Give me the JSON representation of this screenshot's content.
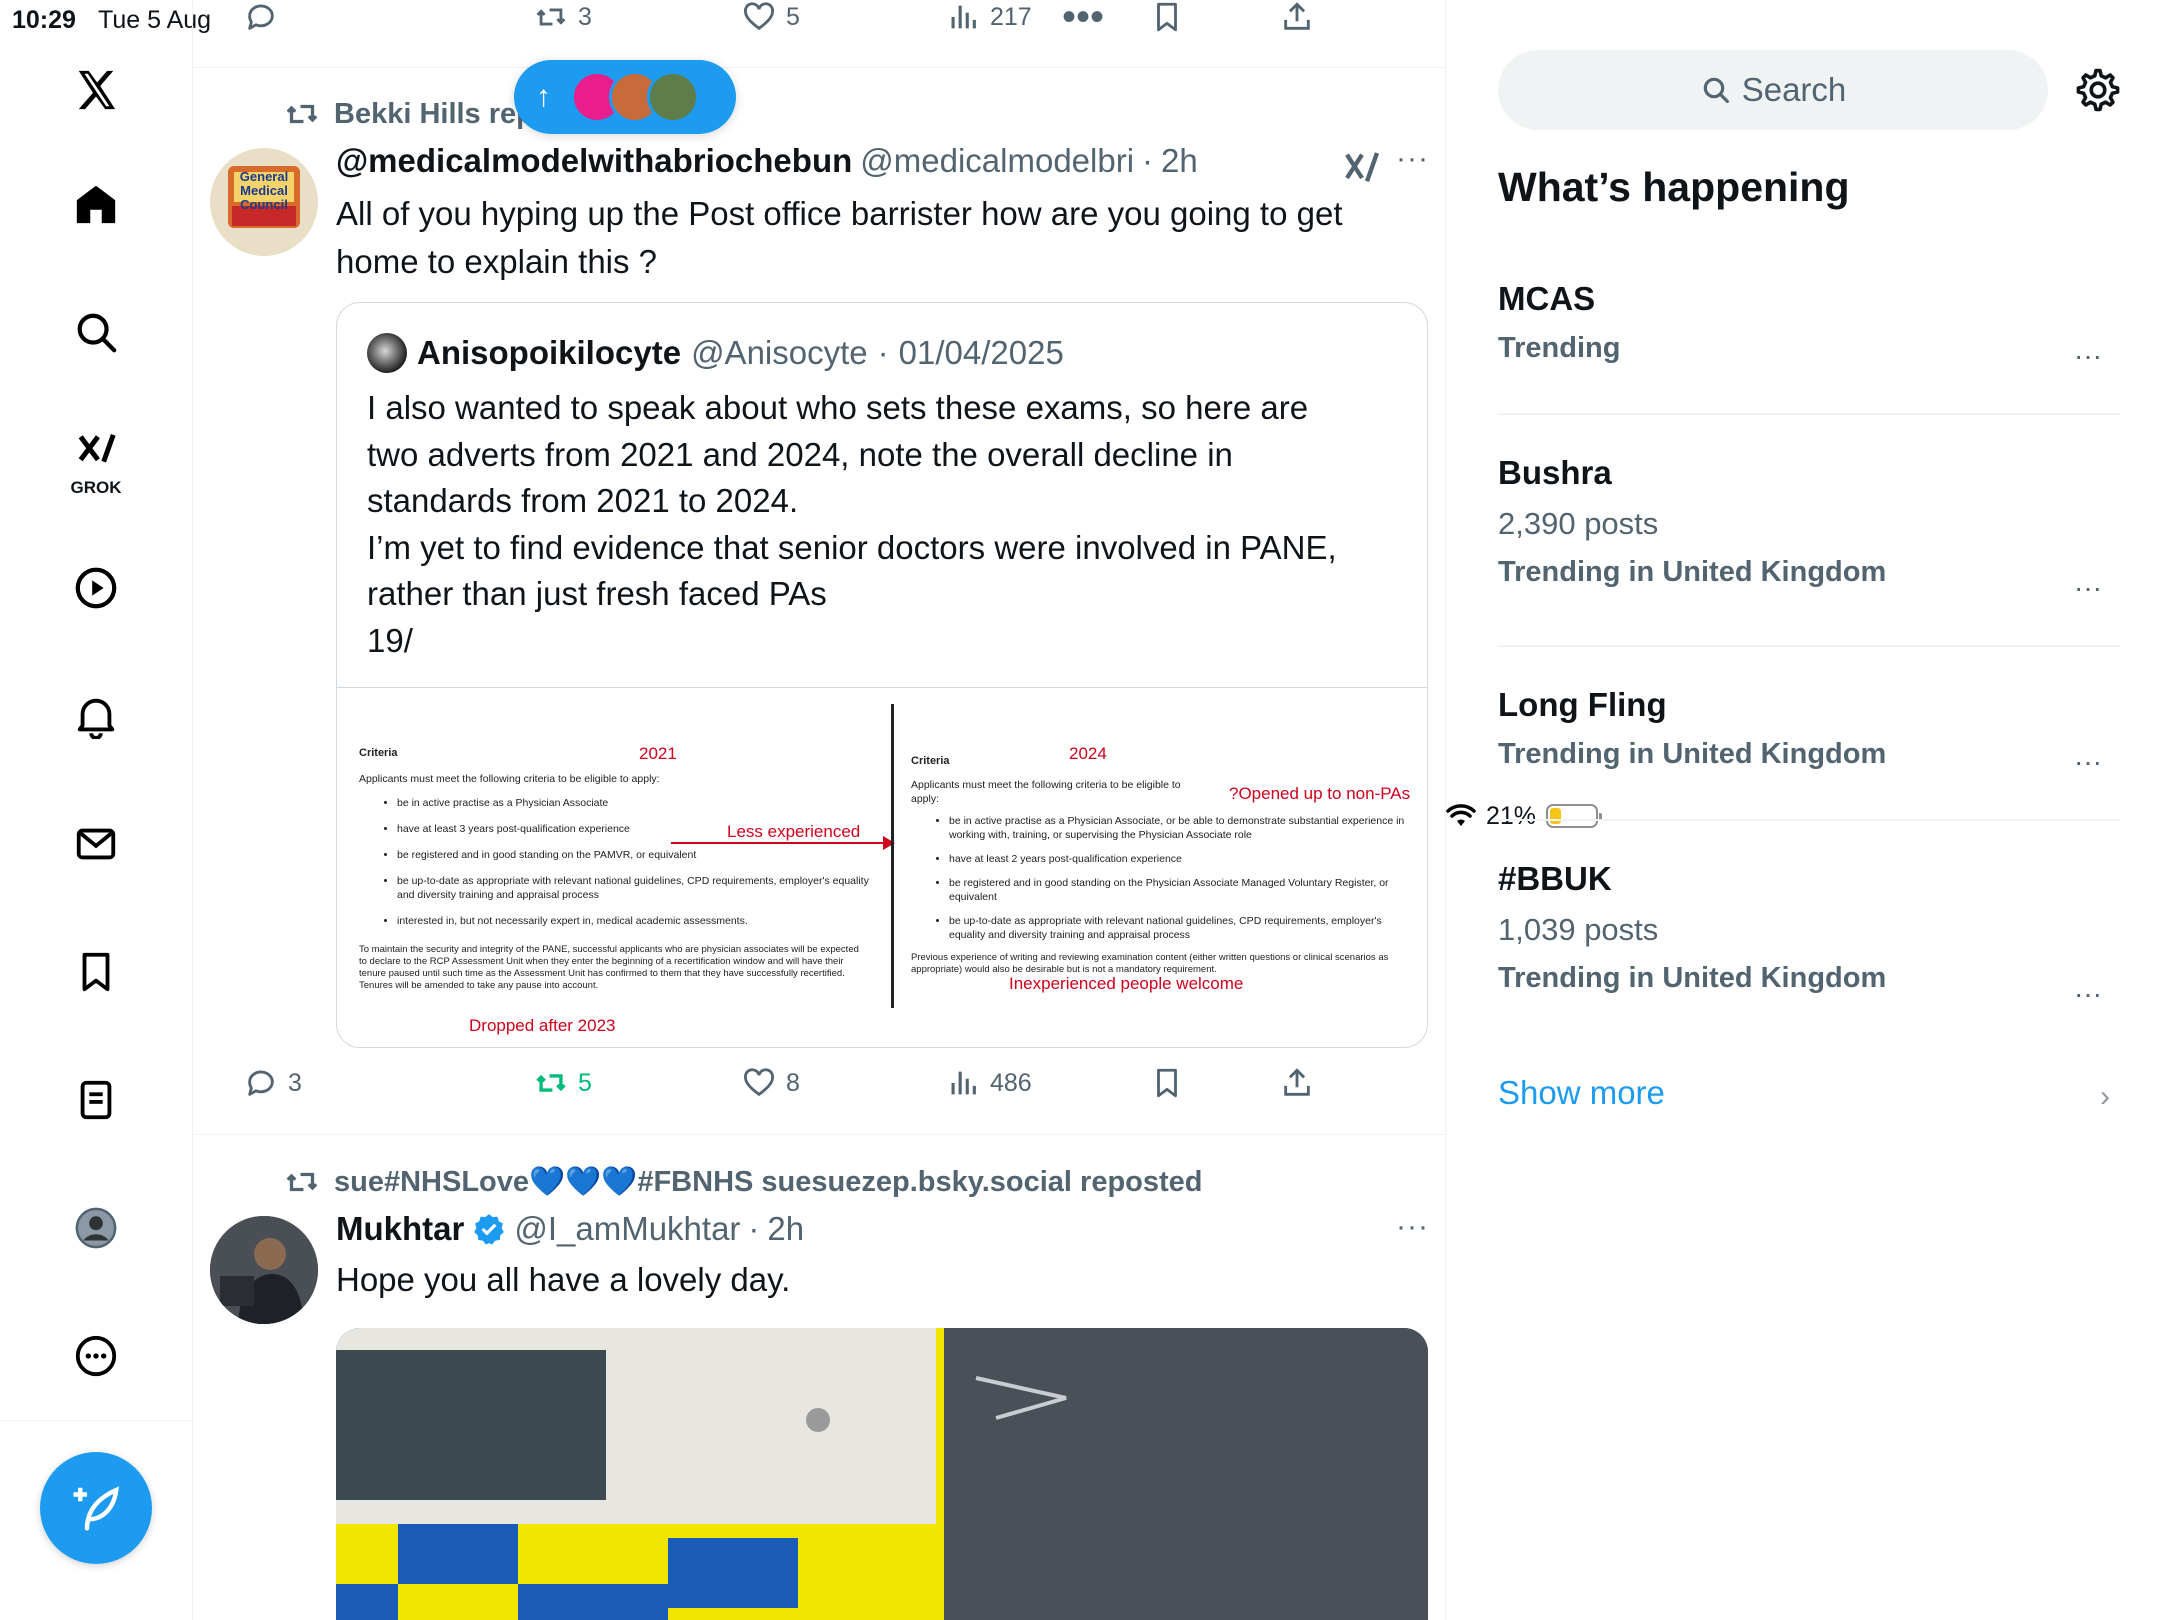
{
  "status_bar": {
    "time": "10:29",
    "date": "Tue 5 Aug",
    "battery": "21%"
  },
  "top_post_actions": {
    "replies": "",
    "reposts": "3",
    "likes": "5",
    "views": "217"
  },
  "new_posts_pill": {
    "arrow": "↑"
  },
  "post1": {
    "repost_by": "Bekki Hills reposted",
    "name": "@medicalmodelwithabriochebun",
    "handle": "@medicalmodelbri",
    "sep": "·",
    "time": "2h",
    "text": "All of you hyping up the Post office barrister how are you going to get home to explain this ?",
    "avatar_text": "General Medical Council",
    "quote": {
      "name": "Anisopoikilocyte",
      "handle": "@Anisocyte",
      "sep": "·",
      "date": "01/04/2025",
      "text_lines": [
        "I also wanted to speak about who sets these exams, so here are",
        "two adverts from 2021 and 2024, note the overall decline in",
        "standards from 2021 to 2024.",
        "I’m yet to find evidence that senior doctors were involved in PANE,",
        "rather than just fresh faced PAs",
        "19/"
      ],
      "image": {
        "left_year": "2021",
        "right_year": "2024",
        "criteria": "Criteria",
        "intro": "Applicants must meet the following criteria to be eligible to apply:",
        "left_bullets": [
          "be in active practise as a Physician Associate",
          "have at least 3 years post-qualification experience",
          "be registered and in good standing on the PAMVR, or equivalent",
          "be up-to-date as appropriate with relevant national guidelines, CPD requirements, employer's equality and diversity training and appraisal process",
          "interested in, but not necessarily expert in, medical academic assessments."
        ],
        "left_footer": "To maintain the security and integrity of the PANE, successful applicants who are physician associates will be expected to declare to the RCP Assessment Unit when they enter the beginning of a recertification window and will have their tenure paused until such time as the Assessment Unit has confirmed to them that they have successfully recertified. Tenures will be amended to take any pause into account.",
        "right_bullets": [
          "be in active practise as a Physician Associate, or be able to demonstrate substantial experience in working with, training, or supervising the Physician Associate role",
          "have at least 2 years post-qualification experience",
          "be registered and in good standing on the Physician Associate Managed Voluntary Register, or equivalent",
          "be up-to-date as appropriate with relevant national guidelines, CPD requirements, employer's equality and diversity training and appraisal process"
        ],
        "right_footer": "Previous experience of writing and reviewing examination content (either written questions or clinical scenarios as appropriate) would also be desirable but is not a mandatory requirement.",
        "ann_less": "Less experienced",
        "ann_opened": "?Opened up to non-PAs",
        "ann_inexperienced": "Inexperienced people welcome",
        "ann_dropped": "Dropped after 2023"
      }
    },
    "actions": {
      "replies": "3",
      "reposts": "5",
      "likes": "8",
      "views": "486"
    }
  },
  "post2": {
    "repost_by": "sue#NHSLove💙💙💙#FBNHS suesuezep.bsky.social reposted",
    "name": "Mukhtar",
    "handle": "@I_amMukhtar",
    "sep": "·",
    "time": "2h",
    "text": "Hope you all have a lovely day."
  },
  "nav": {
    "grok_label": "GROK"
  },
  "right": {
    "search_placeholder": "Search",
    "section_title": "What’s happening",
    "trends": [
      {
        "name": "MCAS",
        "posts": "",
        "context": "Trending"
      },
      {
        "name": "Bushra",
        "posts": "2,390 posts",
        "context": "Trending in United Kingdom"
      },
      {
        "name": "Long Fling",
        "posts": "",
        "context": "Trending in United Kingdom"
      },
      {
        "name": "#BBUK",
        "posts": "1,039 posts",
        "context": "Trending in United Kingdom"
      }
    ],
    "show_more": "Show more",
    "more_glyph": "···",
    "chevron": "›"
  },
  "colors": {
    "accent": "#1d9bf0",
    "repost_green": "#00ba7c",
    "muted": "#536471",
    "annotation_red": "#d0021b"
  }
}
